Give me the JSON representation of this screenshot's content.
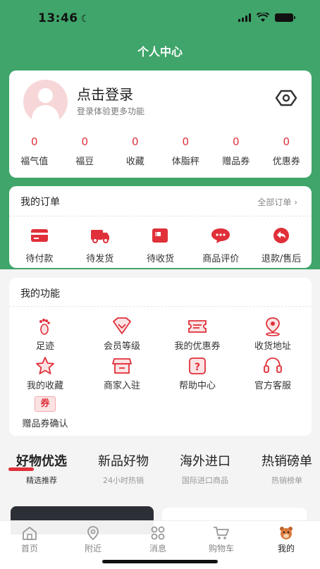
{
  "status": {
    "time": "13:46"
  },
  "header": {
    "title": "个人中心"
  },
  "profile": {
    "login_title": "点击登录",
    "login_subtitle": "登录体验更多功能",
    "stats": [
      {
        "value": "0",
        "label": "福气值"
      },
      {
        "value": "0",
        "label": "福豆"
      },
      {
        "value": "0",
        "label": "收藏"
      },
      {
        "value": "0",
        "label": "体脂秤"
      },
      {
        "value": "0",
        "label": "赠品券"
      },
      {
        "value": "0",
        "label": "优惠券"
      }
    ]
  },
  "orders": {
    "title": "我的订单",
    "all_link": "全部订单",
    "items": [
      {
        "label": "待付款",
        "icon": "wallet-icon"
      },
      {
        "label": "待发货",
        "icon": "truck-icon"
      },
      {
        "label": "待收货",
        "icon": "package-icon"
      },
      {
        "label": "商品评价",
        "icon": "comment-icon"
      },
      {
        "label": "退款/售后",
        "icon": "return-icon"
      }
    ]
  },
  "functions": {
    "title": "我的功能",
    "items": [
      {
        "label": "足迹",
        "icon": "footprint-icon"
      },
      {
        "label": "会员等级",
        "icon": "vip-icon"
      },
      {
        "label": "我的优惠券",
        "icon": "coupon-icon"
      },
      {
        "label": "收货地址",
        "icon": "location-icon"
      },
      {
        "label": "我的收藏",
        "icon": "star-icon"
      },
      {
        "label": "商家入驻",
        "icon": "store-icon"
      },
      {
        "label": "帮助中心",
        "icon": "help-icon"
      },
      {
        "label": "官方客服",
        "icon": "headset-icon"
      },
      {
        "label": "赠品券确认",
        "icon": "gift-voucher-icon",
        "badge": "券"
      }
    ]
  },
  "tabs": [
    {
      "title": "好物优选",
      "subtitle": "精选推荐",
      "active": true
    },
    {
      "title": "新品好物",
      "subtitle": "24小时热销"
    },
    {
      "title": "海外进口",
      "subtitle": "国际进口商品"
    },
    {
      "title": "热销磅单",
      "subtitle": "热销榜单"
    }
  ],
  "tabbar": [
    {
      "label": "首页",
      "icon": "home-icon"
    },
    {
      "label": "附近",
      "icon": "nearby-icon"
    },
    {
      "label": "消息",
      "icon": "message-icon"
    },
    {
      "label": "购物车",
      "icon": "cart-icon"
    },
    {
      "label": "我的",
      "icon": "my-icon",
      "active": true
    }
  ],
  "colors": {
    "brand_green": "#3fa56a",
    "accent_red": "#e0303a"
  }
}
